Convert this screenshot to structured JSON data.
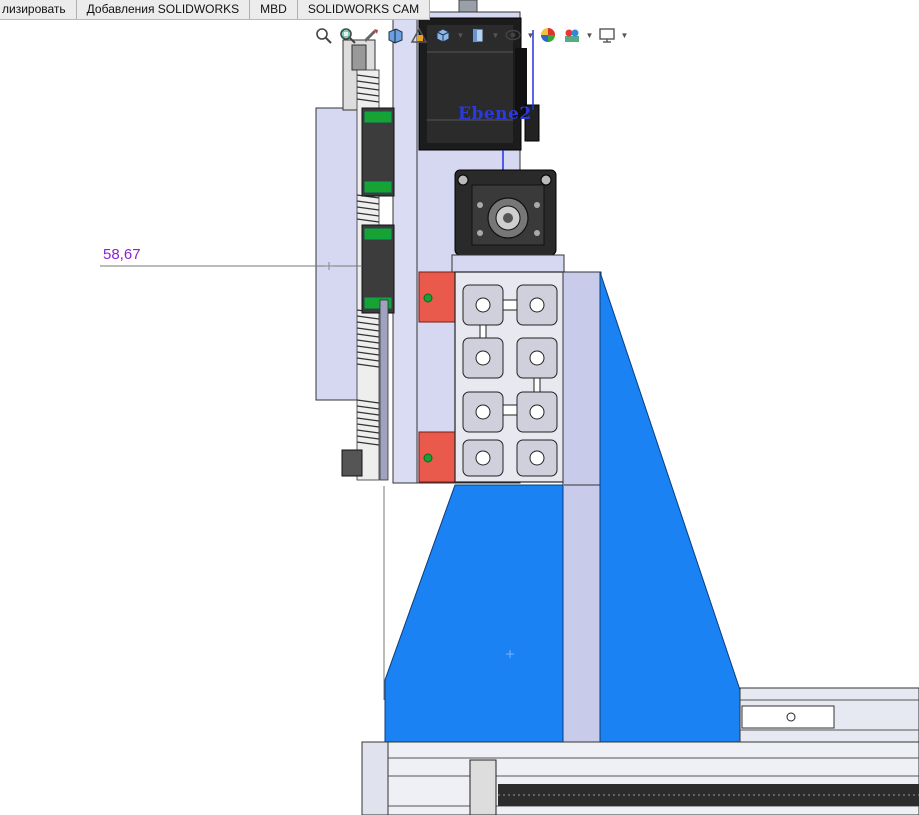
{
  "command_tabs": [
    {
      "label": "лизировать"
    },
    {
      "label": "Добавления SOLIDWORKS"
    },
    {
      "label": "MBD"
    },
    {
      "label": "SOLIDWORKS CAM"
    }
  ],
  "view_toolbar": {
    "icons": [
      "zoom-to-fit-icon",
      "zoom-to-area-icon",
      "previous-view-icon",
      "section-view-icon",
      "dynamic-annotation-icon",
      "view-orientation-icon",
      "display-style-icon",
      "hide-show-items-icon",
      "edit-appearance-icon",
      "apply-scene-icon",
      "view-settings-icon"
    ]
  },
  "dimension": {
    "value": "58,67"
  },
  "plane": {
    "label": "Ebene2"
  },
  "colors": {
    "background": "#ffffff",
    "blue_plate": "#1a82f2",
    "light_part": "#d6d8f2",
    "dimension_text": "#8b20d6",
    "plane_text": "#2a3adf",
    "rail_green": "#17a331",
    "carriage_red": "#ea5a4c"
  }
}
